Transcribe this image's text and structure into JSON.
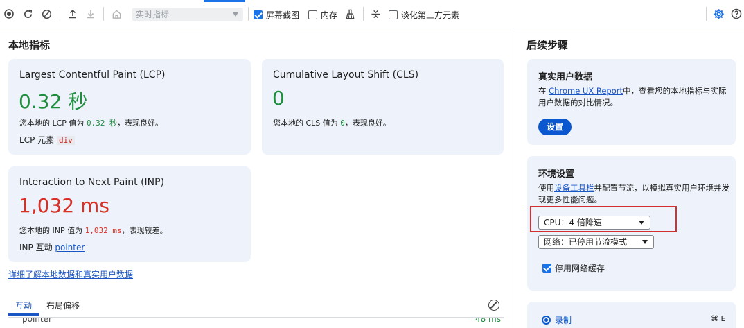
{
  "toolbar": {
    "view_select": "实时指标",
    "screenshots_label": "屏幕截图",
    "memory_label": "内存",
    "dim_third_party_label": "淡化第三方元素",
    "icons": [
      "record-icon",
      "reload-icon",
      "clear-icon",
      "upload-icon",
      "download-icon",
      "home-icon",
      "broom-icon",
      "collapse-icon",
      "settings-gear-icon",
      "help-icon"
    ]
  },
  "local": {
    "heading": "本地指标",
    "lcp": {
      "title": "Largest Contentful Paint (LCP)",
      "value": "0.32 秒",
      "desc_prefix": "您本地的 LCP 值为 ",
      "desc_value": "0.32 秒",
      "desc_suffix": "，表现良好。",
      "element_label": "LCP 元素 ",
      "element_value": "div"
    },
    "cls": {
      "title": "Cumulative Layout Shift (CLS)",
      "value": "0",
      "desc_prefix": "您本地的 CLS 值为 ",
      "desc_value": "0",
      "desc_suffix": "，表现良好。"
    },
    "inp": {
      "title": "Interaction to Next Paint (INP)",
      "value": "1,032 ms",
      "desc_prefix": "您本地的 INP 值为 ",
      "desc_value": "1,032 ms",
      "desc_suffix": "，表现较差。",
      "interaction_label": "INP 互动 ",
      "interaction_value": "pointer"
    },
    "learn_more": "详细了解本地数据和真实用户数据",
    "tabs": [
      "互动",
      "布局偏移"
    ],
    "row_peek": {
      "label": "pointer",
      "value": "48 ms"
    }
  },
  "side": {
    "heading": "后续步骤",
    "field": {
      "title": "真实用户数据",
      "text_prefix": "在 ",
      "text_link": "Chrome UX Report",
      "text_suffix": "中，查看您的本地指标与实际用户数据的对比情况。",
      "button": "设置"
    },
    "env": {
      "title": "环境设置",
      "text_prefix": "使用",
      "text_link": "设备工具栏",
      "text_suffix": "并配置节流，以模拟真实用户环境并发现更多性能问题。",
      "cpu_select": "CPU：4 倍降速",
      "network_select": "网络：已停用节流模式",
      "disable_cache_label": "停用网络缓存"
    },
    "record": {
      "label": "录制",
      "shortcut": "⌘ E"
    }
  }
}
